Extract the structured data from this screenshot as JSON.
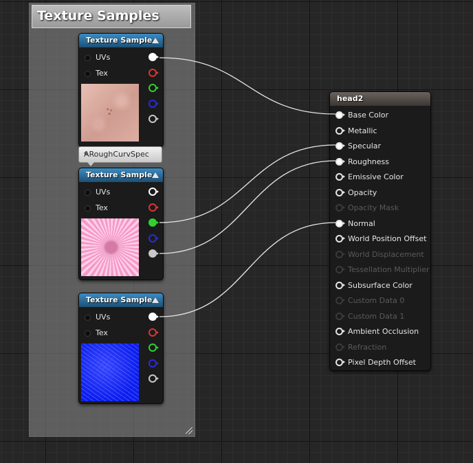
{
  "comment": {
    "title": "Texture Samples"
  },
  "texture_nodes": [
    {
      "title": "Texture Sample",
      "inputs": [
        "UVs",
        "Tex"
      ],
      "outputs": [
        "rgb",
        "r",
        "g",
        "b",
        "a"
      ],
      "output_colors": [
        "#ffffff",
        "#e03232",
        "#2fd22f",
        "#2a2ae0",
        "#c8c8c8"
      ],
      "thumbnail": "skin-color-texture"
    },
    {
      "title": "Texture Sample",
      "inputs": [
        "UVs",
        "Tex"
      ],
      "outputs": [
        "rgb",
        "r",
        "g",
        "b",
        "a"
      ],
      "output_colors": [
        "#ffffff",
        "#e03232",
        "#2fd22f",
        "#2a2ae0",
        "#c8c8c8"
      ],
      "thumbnail": "pink-roughness-specular-texture"
    },
    {
      "title": "Texture Sample",
      "inputs": [
        "UVs",
        "Tex"
      ],
      "outputs": [
        "rgb",
        "r",
        "g",
        "b",
        "a"
      ],
      "output_colors": [
        "#ffffff",
        "#e03232",
        "#2fd22f",
        "#2a2ae0",
        "#c8c8c8"
      ],
      "thumbnail": "blue-normal-map-texture"
    }
  ],
  "parameter_tag": {
    "label": "ARoughCurvSpec"
  },
  "material_node": {
    "title": "head2",
    "pins": [
      {
        "label": "Base Color",
        "connected": true,
        "enabled": true
      },
      {
        "label": "Metallic",
        "connected": false,
        "enabled": true
      },
      {
        "label": "Specular",
        "connected": true,
        "enabled": true
      },
      {
        "label": "Roughness",
        "connected": true,
        "enabled": true
      },
      {
        "label": "Emissive Color",
        "connected": false,
        "enabled": true
      },
      {
        "label": "Opacity",
        "connected": false,
        "enabled": true
      },
      {
        "label": "Opacity Mask",
        "connected": false,
        "enabled": false
      },
      {
        "label": "Normal",
        "connected": true,
        "enabled": true
      },
      {
        "label": "World Position Offset",
        "connected": false,
        "enabled": true
      },
      {
        "label": "World Displacement",
        "connected": false,
        "enabled": false
      },
      {
        "label": "Tessellation Multiplier",
        "connected": false,
        "enabled": false
      },
      {
        "label": "Subsurface Color",
        "connected": false,
        "enabled": true
      },
      {
        "label": "Custom Data 0",
        "connected": false,
        "enabled": false
      },
      {
        "label": "Custom Data 1",
        "connected": false,
        "enabled": false
      },
      {
        "label": "Ambient Occlusion",
        "connected": false,
        "enabled": true
      },
      {
        "label": "Refraction",
        "connected": false,
        "enabled": false
      },
      {
        "label": "Pixel Depth Offset",
        "connected": false,
        "enabled": true
      }
    ]
  },
  "connections": [
    {
      "from_node": 0,
      "from_output": "rgb",
      "to_pin": "Base Color"
    },
    {
      "from_node": 1,
      "from_output": "g",
      "to_pin": "Specular"
    },
    {
      "from_node": 1,
      "from_output": "a",
      "to_pin": "Roughness"
    },
    {
      "from_node": 2,
      "from_output": "rgb",
      "to_pin": "Normal"
    }
  ]
}
